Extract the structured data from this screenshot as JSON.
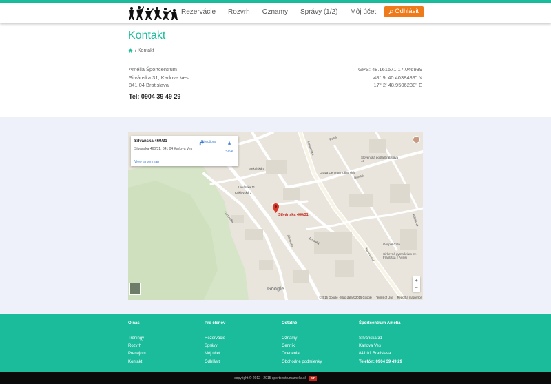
{
  "header": {
    "nav": [
      "Rezervácie",
      "Rozvrh",
      "Oznamy",
      "Správy (1/2)",
      "Môj účet"
    ],
    "logout": "Odhlásiť"
  },
  "page": {
    "title": "Kontakt",
    "breadcrumb": "/ Kontakt"
  },
  "contact": {
    "name": "Amélia Športcentrum",
    "street": "Silvánska 31, Karlova Ves",
    "city": "841 04 Bratislava",
    "tel": "Tel: 0904 39 49 29",
    "gps1": "GPS: 48.161571,17.046939",
    "gps2": "48° 9' 40.4038489\" N",
    "gps3": "17° 2' 48.9506238\" E"
  },
  "map": {
    "card_title": "Silvánska 460/31",
    "card_address": "Silvánska 460/31, 841 04 Karlova Ves",
    "view_larger": "View larger map",
    "directions": "Directions",
    "save": "Save",
    "pin_label": "Silvánska 460/31",
    "labels": {
      "l1": "Sekulská 5",
      "l2": "Levárska 11",
      "l3": "Kuklovská 3",
      "l4": "Kuklovská",
      "l5": "Pustá",
      "l6": "Karloveská",
      "l7": "Slovenská pošta Bratislava 43",
      "l8": "Orava Centrum Záhorská",
      "l9": "Borská",
      "l10": "Silvánska",
      "l11": "Brodská",
      "l12": "Gospel Café",
      "l13": "Cirkevné gymnázium sv. Františka z Assisi",
      "l14": "Pribinova",
      "l15": "Karloveská"
    },
    "google": "Google",
    "attribution": [
      "©2015 Google · Map data ©2015 Google",
      "Terms of Use",
      "Report a map error"
    ],
    "zoom_in": "+",
    "zoom_out": "−"
  },
  "footer": {
    "col1": {
      "title": "O nás",
      "items": [
        "Tréningy",
        "Rozvrh",
        "Prenájom",
        "Kontakt"
      ]
    },
    "col2": {
      "title": "Pre členov",
      "items": [
        "Rezervácie",
        "Správy",
        "Môj účet",
        "Odhlásiť"
      ]
    },
    "col3": {
      "title": "Ostatné",
      "items": [
        "Oznamy",
        "Cenník",
        "Ocenenia",
        "Obchodné podmienky"
      ]
    },
    "col4": {
      "title": "Športcentrum Amélia",
      "items": [
        "Silvánska 31",
        "Karlova Ves",
        "841 01 Bratislava",
        "Telefón: 0904 39 49 29"
      ]
    },
    "copyright": "copyright © 2012 - 2015 sportcentrumamelia.sk",
    "badge": "MP"
  },
  "colors": {
    "accent": "#1abc9c",
    "logout": "#ef7a1a",
    "pin": "#c0281e"
  }
}
